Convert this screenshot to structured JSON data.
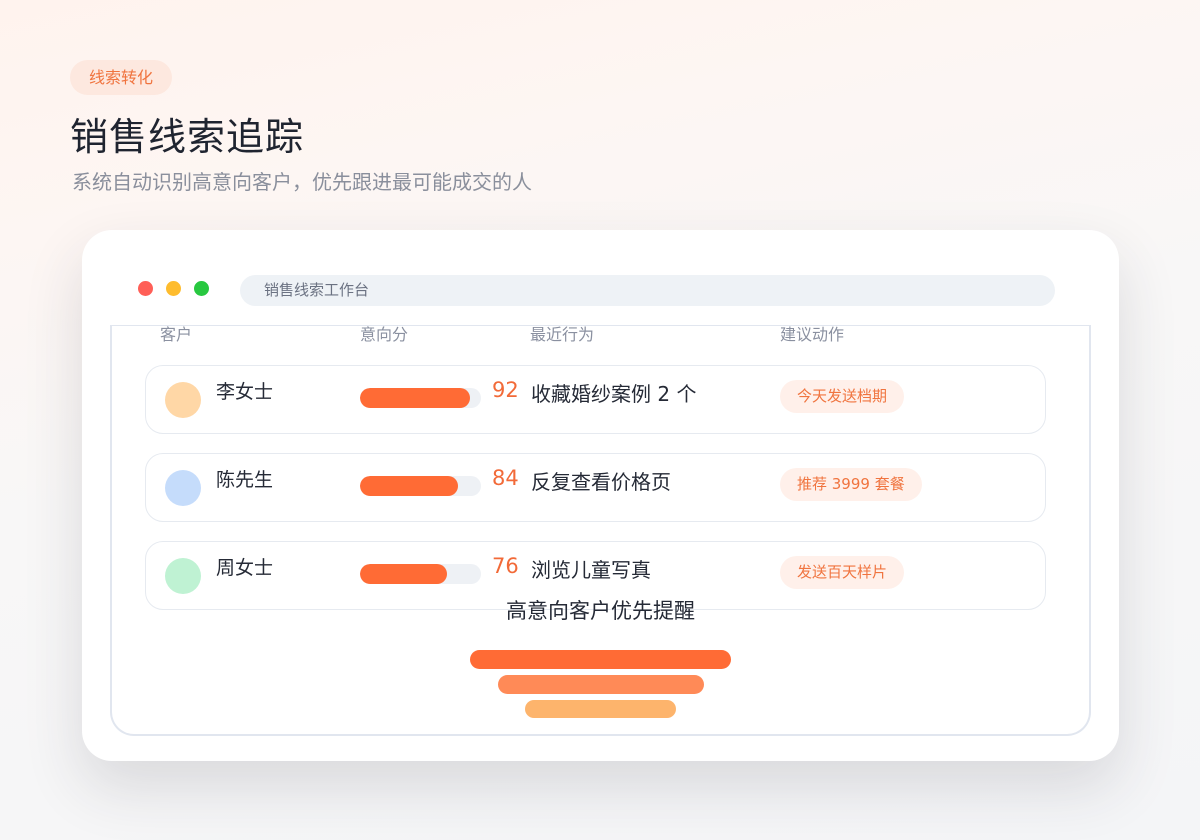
{
  "header": {
    "badge": "线索转化",
    "title": "销售线索追踪",
    "subtitle": "系统自动识别高意向客户，优先跟进最可能成交的人"
  },
  "window": {
    "address_bar": "销售线索工作台",
    "controls": [
      {
        "name": "close",
        "color": "#ff5f57"
      },
      {
        "name": "minimize",
        "color": "#febc2e"
      },
      {
        "name": "maximize",
        "color": "#28c840"
      }
    ]
  },
  "table": {
    "columns": [
      "客户",
      "意向分",
      "最近行为",
      "建议动作"
    ],
    "rows": [
      {
        "name": "李女士",
        "avatar_color": "#ffd7a6",
        "score": "92",
        "score_value": 92,
        "behavior": "收藏婚纱案例 2 个",
        "action": "今天发送档期"
      },
      {
        "name": "陈先生",
        "avatar_color": "#c5dcfb",
        "score": "84",
        "score_value": 84,
        "behavior": "反复查看价格页",
        "action": "推荐 3999 套餐"
      },
      {
        "name": "周女士",
        "avatar_color": "#bff2d3",
        "score": "76",
        "score_value": 76,
        "behavior": "浏览儿童写真",
        "action": "发送百天样片"
      }
    ]
  },
  "funnel": {
    "title": "高意向客户优先提醒",
    "stages": [
      {
        "color": "#ff6b35",
        "share": 1.0
      },
      {
        "color": "#ff8a57",
        "share": 0.79
      },
      {
        "color": "#fdb46c",
        "share": 0.58
      }
    ]
  },
  "colors": {
    "accent": "#ff6b35",
    "accent_text": "#f0743f"
  }
}
